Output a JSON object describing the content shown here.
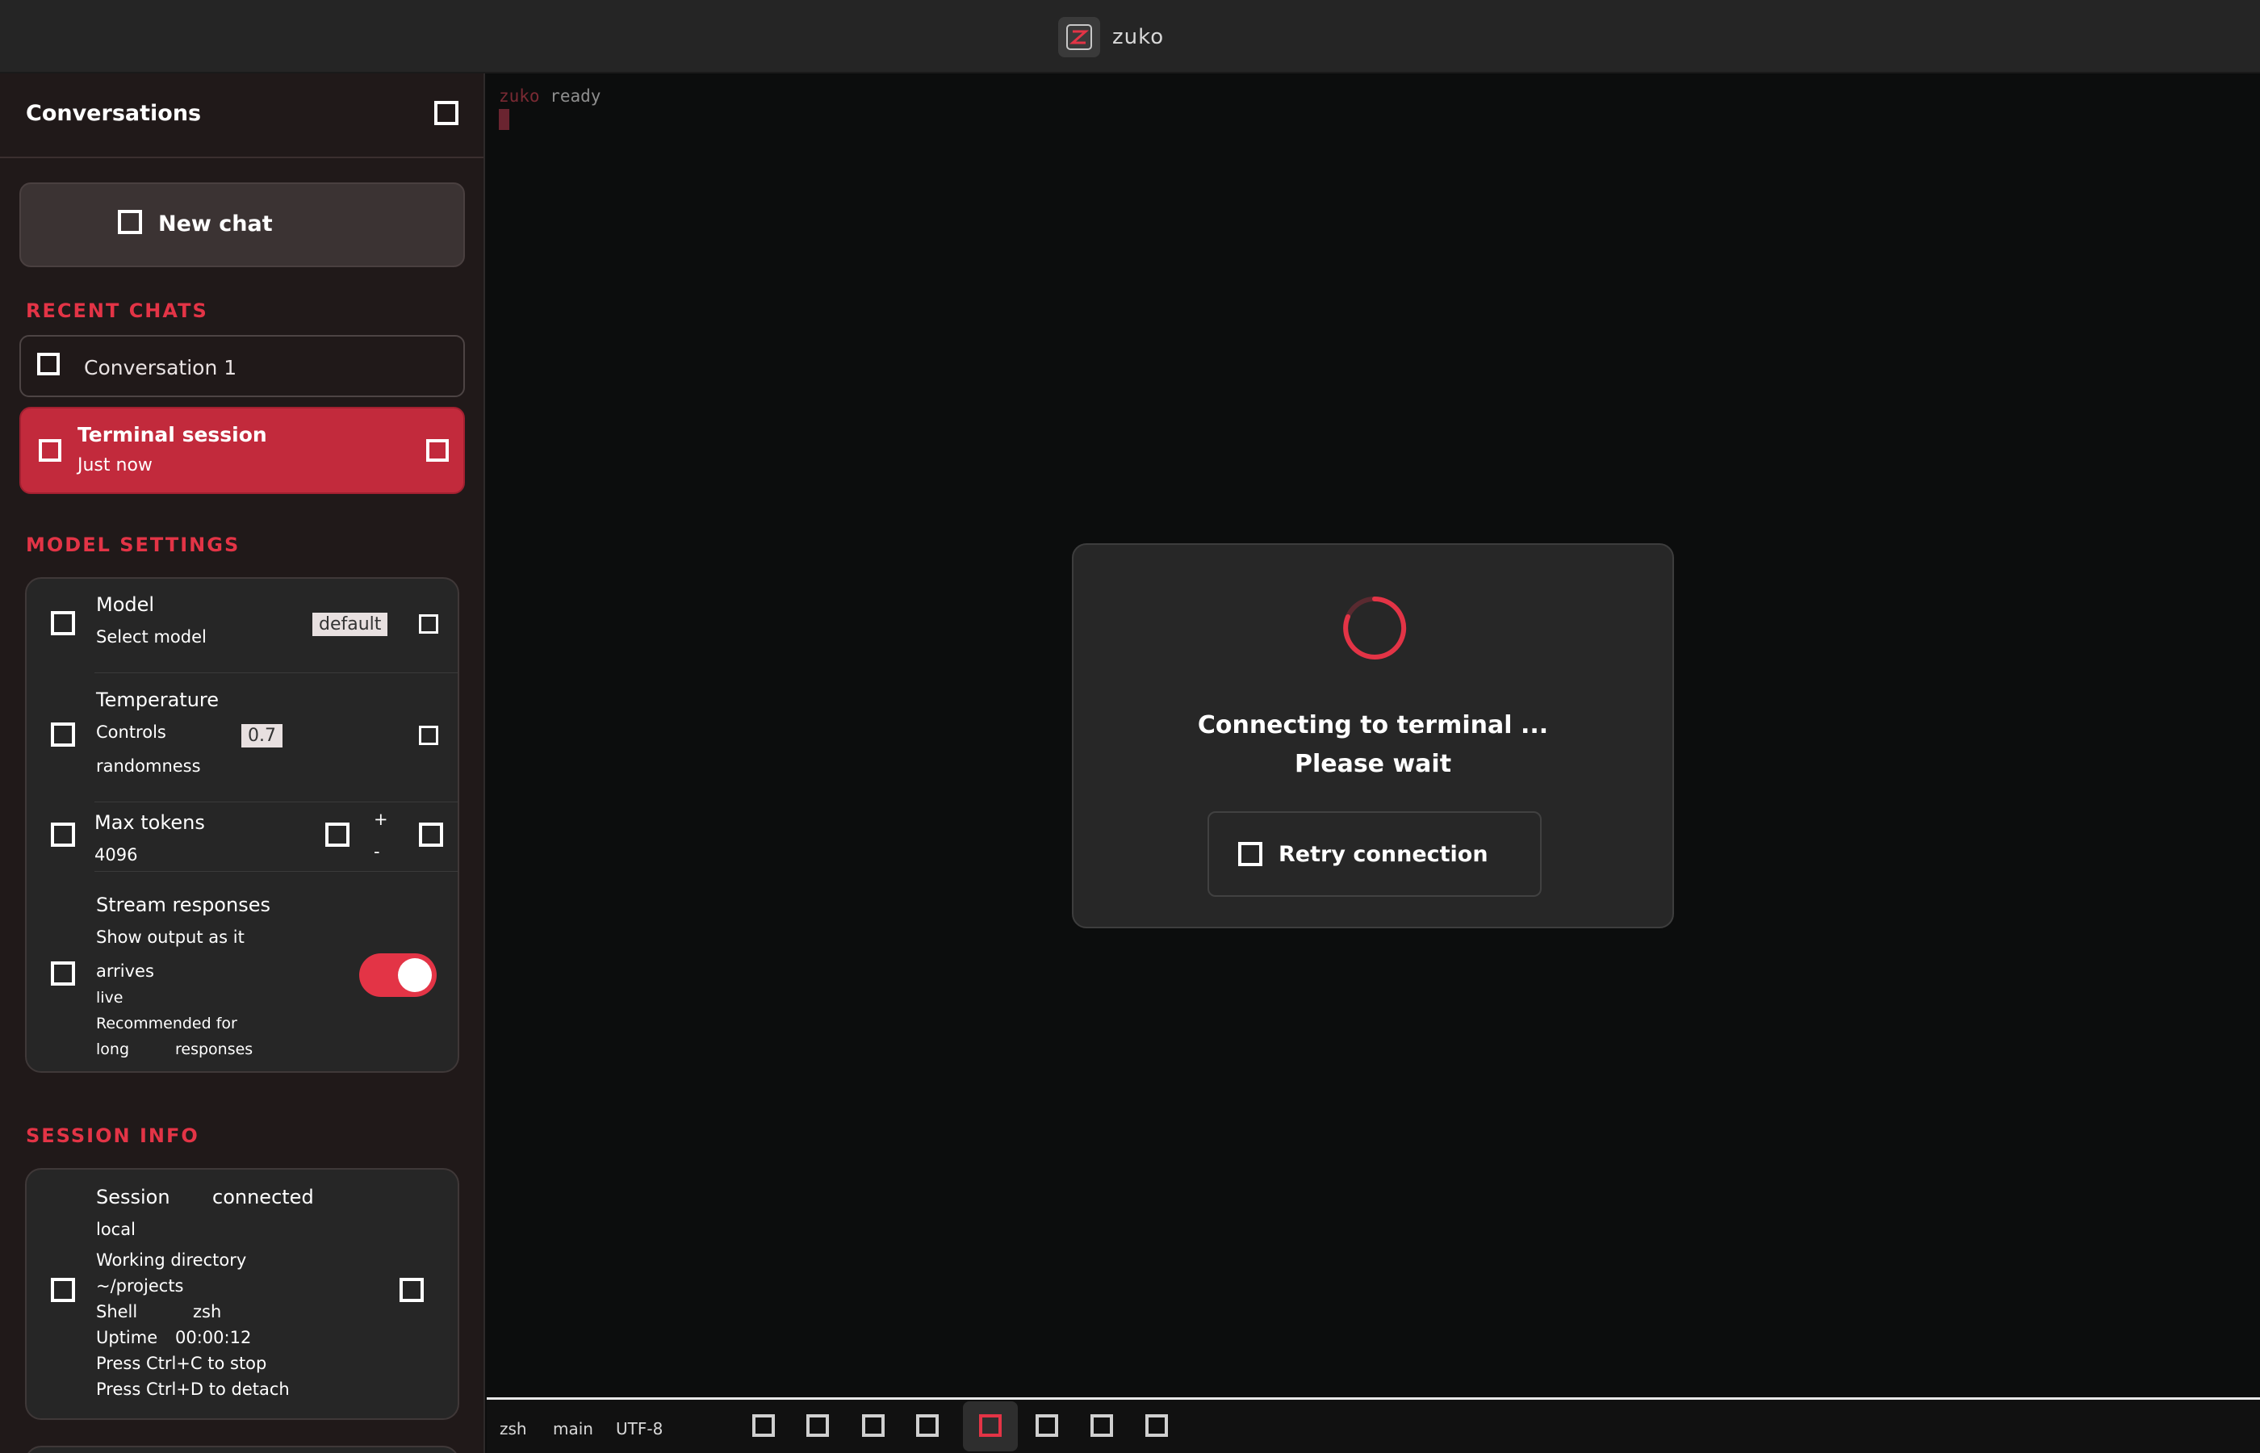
{
  "app": {
    "title": "zuko",
    "logo_icon": "app-logo-icon",
    "accent_color": "#e33446"
  },
  "sidebar": {
    "title": "Conversations",
    "close_icon": "collapse-icon",
    "new_button": {
      "icon": "plus-icon",
      "label": "New chat"
    },
    "recent_label": "RECENT CHATS",
    "conversations": [
      {
        "title": "Conversation 1",
        "active": false
      },
      {
        "title": "Terminal session",
        "subtitle": "Just now",
        "active": true
      }
    ],
    "settings_label": "MODEL SETTINGS",
    "settings": {
      "model": {
        "label": "Model",
        "description": "Select model",
        "value": "default"
      },
      "temperature": {
        "label": "Temperature",
        "line2": "Controls",
        "line3": "randomness",
        "value": "0.7"
      },
      "max_tokens": {
        "label": "Max tokens",
        "line2": "4096",
        "value_top": "+",
        "value_bottom": "-"
      },
      "streaming": {
        "label": "Stream responses",
        "lines": [
          "Show output as it",
          "arrives",
          "live",
          "Recommended for",
          "long",
          "responses"
        ],
        "enabled": true
      }
    },
    "session_label": "SESSION INFO",
    "session": {
      "lines": [
        "Session",
        "connected",
        "local",
        "Working directory",
        "~/projects",
        "Shell",
        "zsh",
        "Uptime",
        "00:00:12",
        "Press Ctrl+C to stop",
        "Press Ctrl+D to detach"
      ]
    }
  },
  "terminal": {
    "prompt": "zuko",
    "status": "ready"
  },
  "modal": {
    "message_line1": "Connecting to terminal",
    "message_line1_tail": "...",
    "message_line2": "Please wait",
    "button_icon": "refresh-icon",
    "button_label": "Retry connection"
  },
  "statusbar": {
    "left_items": [
      "zsh",
      "main",
      "UTF-8"
    ],
    "tools": [
      "split-icon",
      "copy-icon",
      "paste-icon",
      "search-icon",
      "record-icon",
      "settings-icon",
      "share-icon",
      "info-icon"
    ],
    "active_tool": "record-icon"
  }
}
